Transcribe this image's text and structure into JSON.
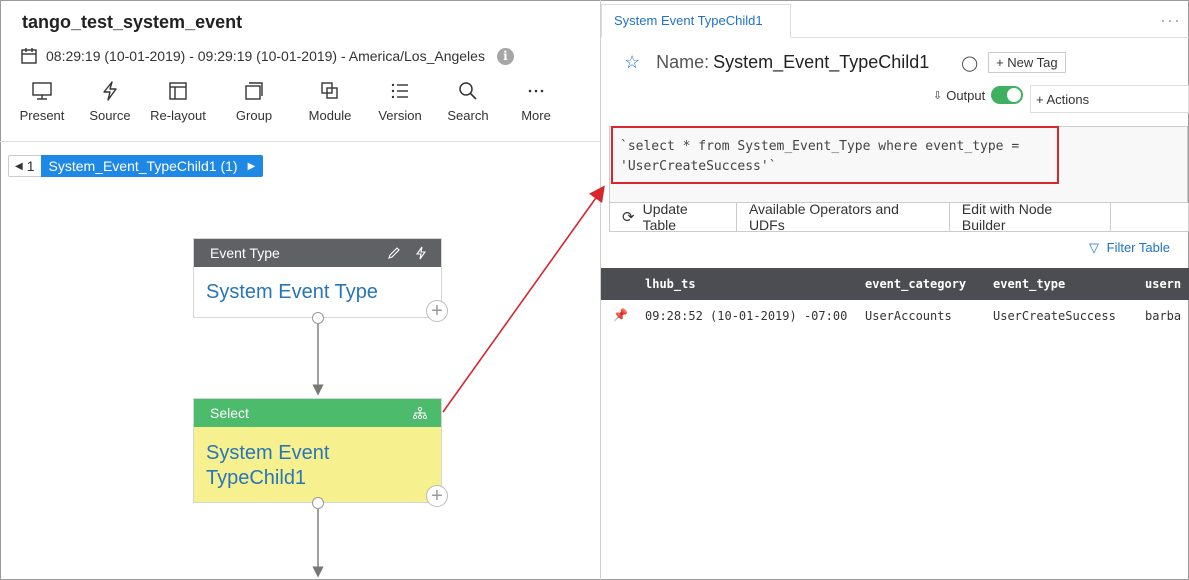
{
  "app": {
    "title": "tango_test_system_event",
    "time_range": "08:29:19 (10-01-2019) - 09:29:19 (10-01-2019) - America/Los_Angeles",
    "info_icon": "i"
  },
  "toolbar": {
    "items": [
      {
        "label": "Present",
        "icon": "monitor-icon"
      },
      {
        "label": "Source",
        "icon": "bolt-icon"
      },
      {
        "label": "Re-layout",
        "icon": "layout-icon"
      },
      {
        "label": "Group",
        "icon": "group-icon"
      },
      {
        "label": "Module",
        "icon": "module-icon"
      },
      {
        "label": "Version",
        "icon": "list-icon"
      },
      {
        "label": "Search",
        "icon": "search-icon"
      },
      {
        "label": "More",
        "icon": "more-icon"
      }
    ]
  },
  "breadcrumb": {
    "number": "1",
    "label": "System_Event_TypeChild1 (1)"
  },
  "nodes": {
    "event_type": {
      "header": "Event Type",
      "body": "System Event Type",
      "header_color": "#5f6165"
    },
    "select": {
      "header": "Select",
      "body_line1": "System Event",
      "body_line2": "TypeChild1",
      "header_color": "#4cbb6c",
      "body_bg": "#f6f08f"
    }
  },
  "detail": {
    "tab_label": "System Event TypeChild1",
    "kebab": "···",
    "name_label": "Name:",
    "name_value": "System_Event_TypeChild1",
    "new_tag_label": "+ New Tag",
    "output_label": "Output",
    "actions_label": "+ Actions",
    "query_line1": "`select * from System_Event_Type where event_type =",
    "query_line2": "'UserCreateSuccess'`",
    "buttons": {
      "update": "Update Table",
      "operators": "Available Operators and UDFs",
      "builder": "Edit with Node Builder"
    },
    "filter_label": "Filter Table"
  },
  "table": {
    "columns": [
      "lhub_ts",
      "event_category",
      "event_type",
      "usern"
    ],
    "rows": [
      [
        "09:28:52 (10-01-2019) -07:00",
        "UserAccounts",
        "UserCreateSuccess",
        "barba"
      ]
    ]
  },
  "colors": {
    "accent": "#1e88e5",
    "annotation": "#d8252e",
    "toggle_on": "#3fb05f"
  }
}
